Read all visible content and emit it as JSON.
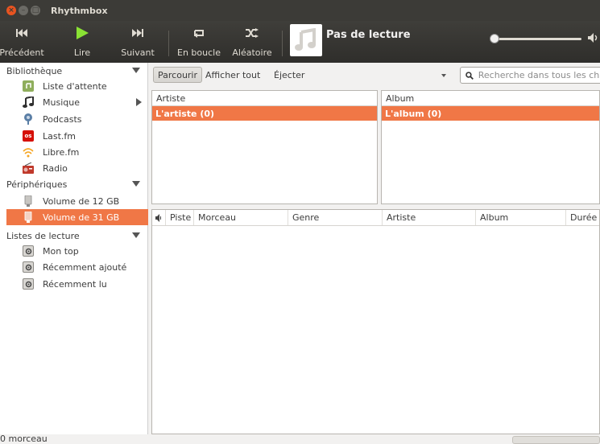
{
  "window": {
    "title": "Rhythmbox"
  },
  "toolbar": {
    "previous_label": "Précédent",
    "play_label": "Lire",
    "next_label": "Suivant",
    "repeat_label": "En boucle",
    "shuffle_label": "Aléatoire",
    "now_playing": "Pas de lecture"
  },
  "colors": {
    "accent": "#f07746",
    "play": "#8ae234",
    "titlebar": "#3c3b37"
  },
  "sidebar": {
    "library_header": "Bibliothèque",
    "library_items": [
      {
        "label": "Liste d'attente",
        "icon": "queue-icon"
      },
      {
        "label": "Musique",
        "icon": "music-note-icon"
      },
      {
        "label": "Podcasts",
        "icon": "podcast-icon"
      },
      {
        "label": "Last.fm",
        "icon": "lastfm-icon"
      },
      {
        "label": "Libre.fm",
        "icon": "librefm-icon"
      },
      {
        "label": "Radio",
        "icon": "radio-icon"
      }
    ],
    "devices_header": "Périphériques",
    "devices_items": [
      {
        "label": "Volume de 12 GB",
        "icon": "usb-drive-icon"
      },
      {
        "label": "Volume de 31 GB",
        "icon": "usb-drive-icon",
        "selected": true
      }
    ],
    "playlists_header": "Listes de lecture",
    "playlists_items": [
      {
        "label": "Mon top",
        "icon": "smart-playlist-icon"
      },
      {
        "label": "Récemment ajouté",
        "icon": "smart-playlist-icon"
      },
      {
        "label": "Récemment lu",
        "icon": "smart-playlist-icon"
      }
    ]
  },
  "browser_bar": {
    "browse_label": "Parcourir",
    "show_all_label": "Afficher tout",
    "eject_label": "Éjecter",
    "search_placeholder": "Recherche dans tous les cha"
  },
  "browser": {
    "artist_header": "Artiste",
    "artist_row": "L'artiste (0)",
    "album_header": "Album",
    "album_row": "L'album (0)"
  },
  "tracks": {
    "columns": [
      "Piste",
      "Morceau",
      "Genre",
      "Artiste",
      "Album",
      "Durée"
    ]
  },
  "status": {
    "text": "0 morceau"
  }
}
